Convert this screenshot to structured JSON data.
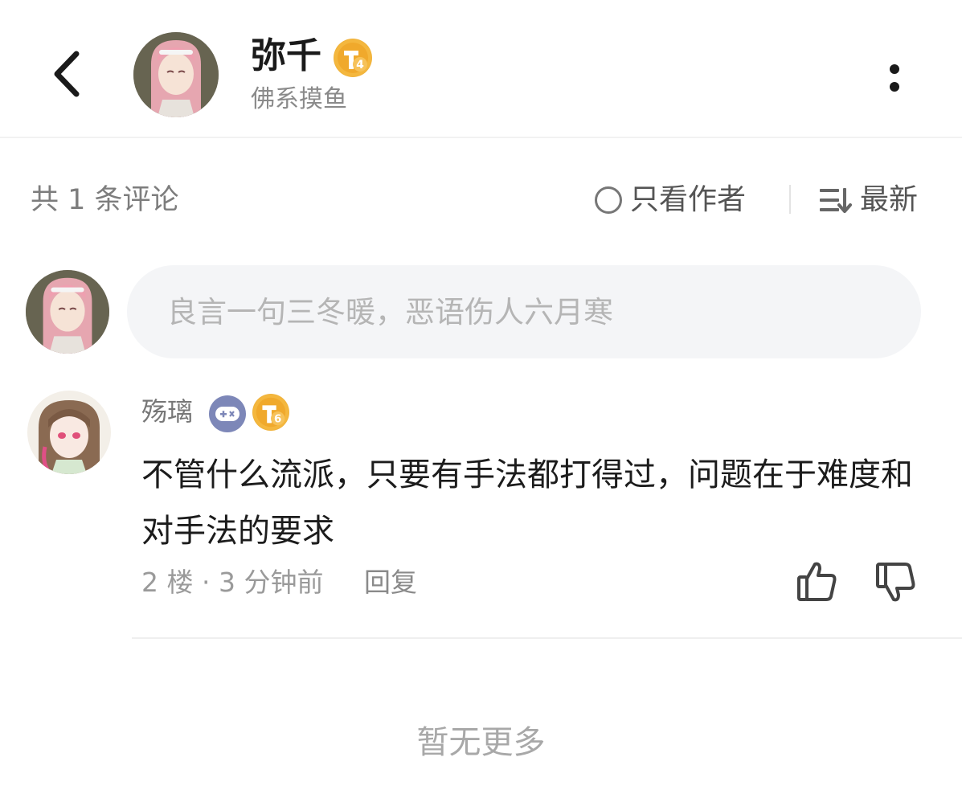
{
  "header": {
    "user_name": "弥千",
    "level_badge": "4",
    "subtitle": "佛系摸鱼"
  },
  "toolbar": {
    "comment_count_label": "共 1 条评论",
    "author_only_label": "只看作者",
    "sort_label": "最新"
  },
  "comment_input": {
    "placeholder": "良言一句三冬暖，恶语伤人六月寒"
  },
  "comments": [
    {
      "user_name": "殇璃",
      "level_badge": "6",
      "text": "不管什么流派，只要有手法都打得过，问题在于难度和对手法的要求",
      "meta": "2 楼 · 3 分钟前",
      "reply_label": "回复"
    }
  ],
  "footer": {
    "no_more_label": "暂无更多"
  },
  "colors": {
    "badge": "#f0b33c",
    "game_badge": "#7d87b8",
    "input_bg": "#f4f5f7"
  }
}
